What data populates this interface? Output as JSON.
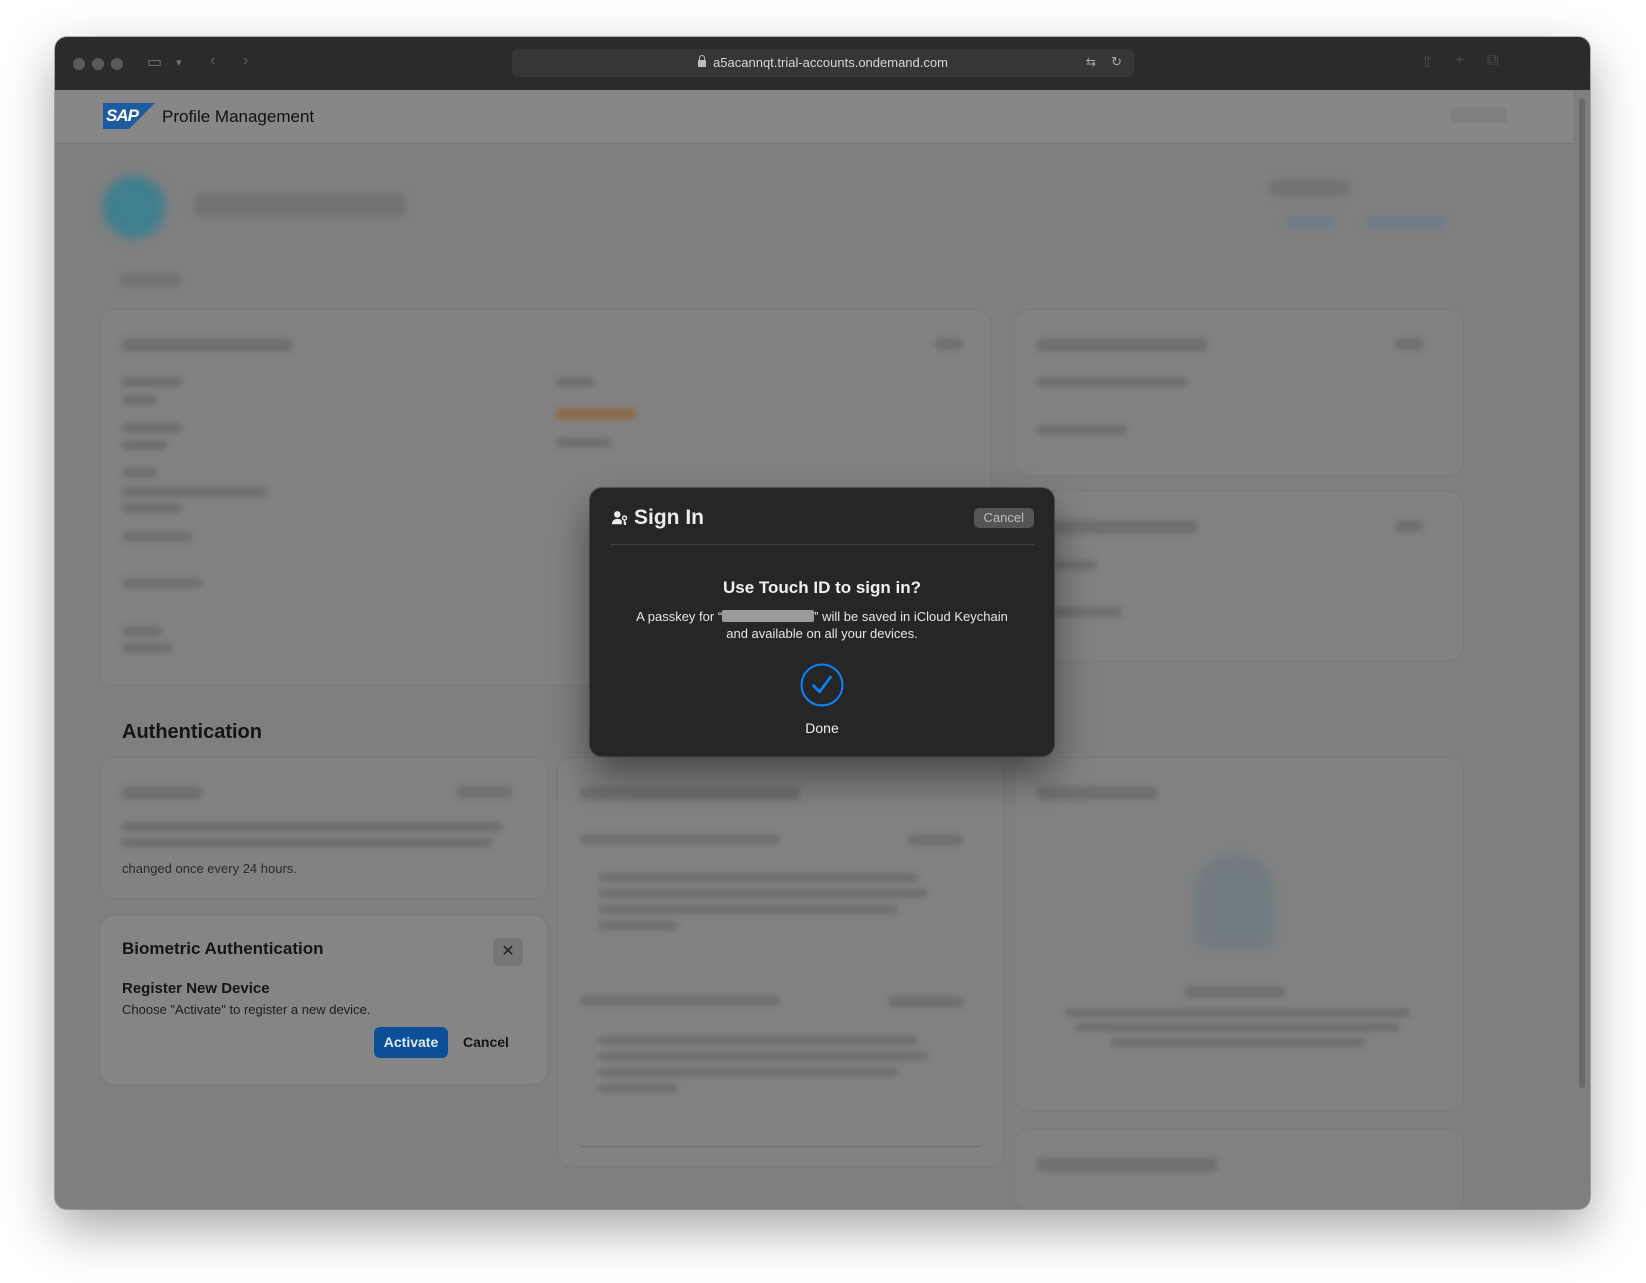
{
  "browser": {
    "url": "a5acannqt.trial-accounts.ondemand.com"
  },
  "app": {
    "logo_text": "SAP",
    "title": "Profile Management"
  },
  "sections": {
    "authentication": "Authentication"
  },
  "password_card": {
    "visible_text": "changed once every 24 hours."
  },
  "biometric": {
    "title": "Biometric Authentication",
    "subtitle": "Register New Device",
    "description": "Choose \"Activate\" to register a new device.",
    "activate_label": "Activate",
    "cancel_label": "Cancel",
    "close_icon": "close-icon"
  },
  "dialog": {
    "title": "Sign In",
    "cancel_label": "Cancel",
    "heading": "Use Touch ID to sign in?",
    "body_before": "A passkey for “",
    "body_after": "” will be saved in iCloud Keychain and available on all your devices.",
    "done_label": "Done",
    "icons": [
      "person-key-icon",
      "checkmark-circle-icon"
    ]
  },
  "colors": {
    "dialog_bg": "#262626",
    "accent_blue": "#0a84ff",
    "activate_button": "#0c4f98",
    "overlay_page": "#7f7f7f"
  }
}
